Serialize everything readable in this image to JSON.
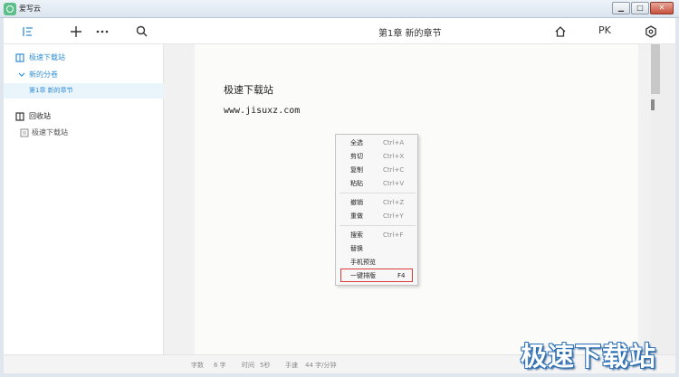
{
  "window": {
    "title": "爱写云",
    "buttons": {
      "minimize": "▁",
      "maximize": "□",
      "close": "✕"
    }
  },
  "toolbar": {
    "chapter_title": "第1章  新的章节",
    "pk_label": "PK",
    "icons": [
      "outline-icon",
      "add-icon",
      "more-icon",
      "search-icon",
      "home-icon",
      "settings-icon"
    ]
  },
  "sidebar": {
    "book_title": "极速下载站",
    "volume": "新的分卷",
    "chapter": "第1章  新的章节",
    "recycle_title": "回收站",
    "recycle_item": "极速下载站"
  },
  "editor": {
    "title": "极速下载站",
    "body": "www.jisuxz.com"
  },
  "context_menu": {
    "items": [
      {
        "label": "全选",
        "shortcut": "Ctrl+A"
      },
      {
        "label": "剪切",
        "shortcut": "Ctrl+X"
      },
      {
        "label": "复制",
        "shortcut": "Ctrl+C"
      },
      {
        "label": "粘贴",
        "shortcut": "Ctrl+V"
      },
      {
        "label": "撤销",
        "shortcut": "Ctrl+Z"
      },
      {
        "label": "重做",
        "shortcut": "Ctrl+Y"
      },
      {
        "label": "搜索",
        "shortcut": "Ctrl+F"
      },
      {
        "label": "替换",
        "shortcut": ""
      },
      {
        "label": "手机预览",
        "shortcut": ""
      },
      {
        "label": "一键排版",
        "shortcut": "F4"
      }
    ]
  },
  "status": {
    "word_label": "字数",
    "word_count": "6 字",
    "time_label": "时间",
    "time_value": "5秒",
    "speed_label": "手速",
    "speed_value": "44 字/分钟"
  },
  "watermark": "极速下载站",
  "colors": {
    "accent": "#2f8fd8",
    "highlight_border": "#d93c3c",
    "watermark": "#2b6fb6"
  }
}
